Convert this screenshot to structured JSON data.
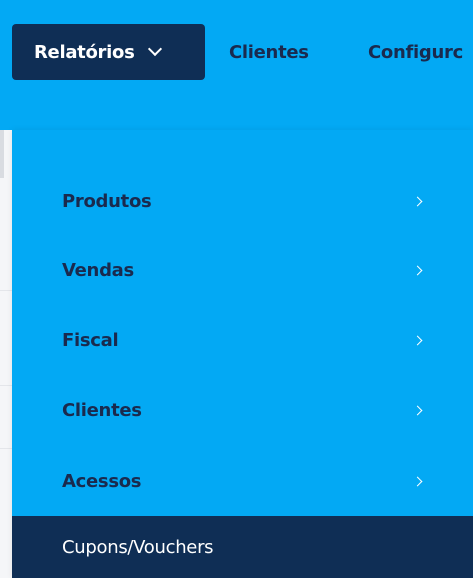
{
  "navbar": {
    "items": [
      {
        "label": "Relatórios",
        "active": true
      },
      {
        "label": "Clientes"
      },
      {
        "label": "Configurc"
      }
    ]
  },
  "dropdown": {
    "items": [
      {
        "label": "Produtos",
        "has_submenu": true
      },
      {
        "label": "Vendas",
        "has_submenu": true
      },
      {
        "label": "Fiscal",
        "has_submenu": true
      },
      {
        "label": "Clientes",
        "has_submenu": true
      },
      {
        "label": "Acessos",
        "has_submenu": true
      },
      {
        "label": "Cupons/Vouchers",
        "has_submenu": false,
        "selected": true
      }
    ]
  },
  "colors": {
    "nav_bg": "#03a9f4",
    "active_bg": "#0f2e55",
    "text_dark": "#1a2a4e",
    "text_light": "#ffffff"
  }
}
